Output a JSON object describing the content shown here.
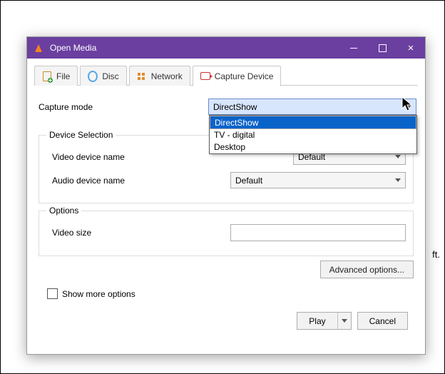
{
  "window": {
    "title": "Open Media"
  },
  "tabs": [
    {
      "label": "File"
    },
    {
      "label": "Disc"
    },
    {
      "label": "Network"
    },
    {
      "label": "Capture Device",
      "active": true
    }
  ],
  "capture_mode": {
    "label": "Capture mode",
    "value": "DirectShow",
    "options": [
      "DirectShow",
      "TV - digital",
      "Desktop"
    ]
  },
  "device_selection": {
    "legend": "Device Selection",
    "video_label": "Video device name",
    "video_value": "Default",
    "audio_label": "Audio device name",
    "audio_value": "Default"
  },
  "options": {
    "legend": "Options",
    "video_size_label": "Video size",
    "video_size_value": ""
  },
  "advanced_label": "Advanced options...",
  "show_more_label": "Show more options",
  "play_label": "Play",
  "cancel_label": "Cancel",
  "stray": "ft."
}
